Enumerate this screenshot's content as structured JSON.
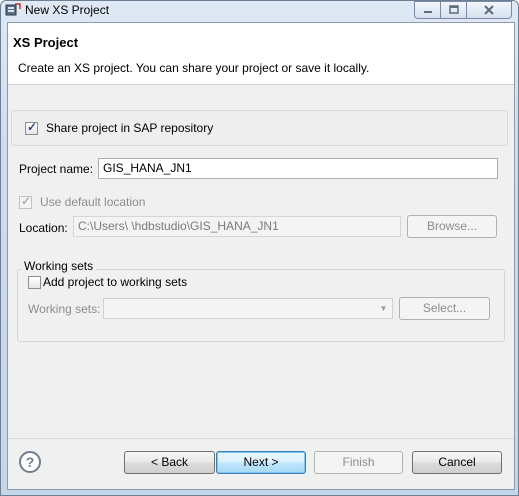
{
  "window": {
    "title": "New XS Project",
    "icon": "eclipse-project-icon"
  },
  "header": {
    "title": "XS Project",
    "description": "Create an XS project. You can share your project or save it locally."
  },
  "share": {
    "label": "Share project in SAP repository",
    "checked": true
  },
  "project_name": {
    "label": "Project name:",
    "value": "GIS_HANA_JN1"
  },
  "default_location": {
    "label": "Use default location",
    "checked": true,
    "enabled": false
  },
  "location": {
    "label": "Location:",
    "value": "C:\\Users\\            \\hdbstudio\\GIS_HANA_JN1",
    "browse_label": "Browse..."
  },
  "working_sets": {
    "group_label": "Working sets",
    "add_label": "Add project to working sets",
    "add_checked": false,
    "sets_label": "Working sets:",
    "sets_value": "",
    "select_label": "Select..."
  },
  "footer": {
    "help_icon": "question-mark-icon",
    "back_label": "< Back",
    "next_label": "Next >",
    "finish_label": "Finish",
    "cancel_label": "Cancel"
  }
}
